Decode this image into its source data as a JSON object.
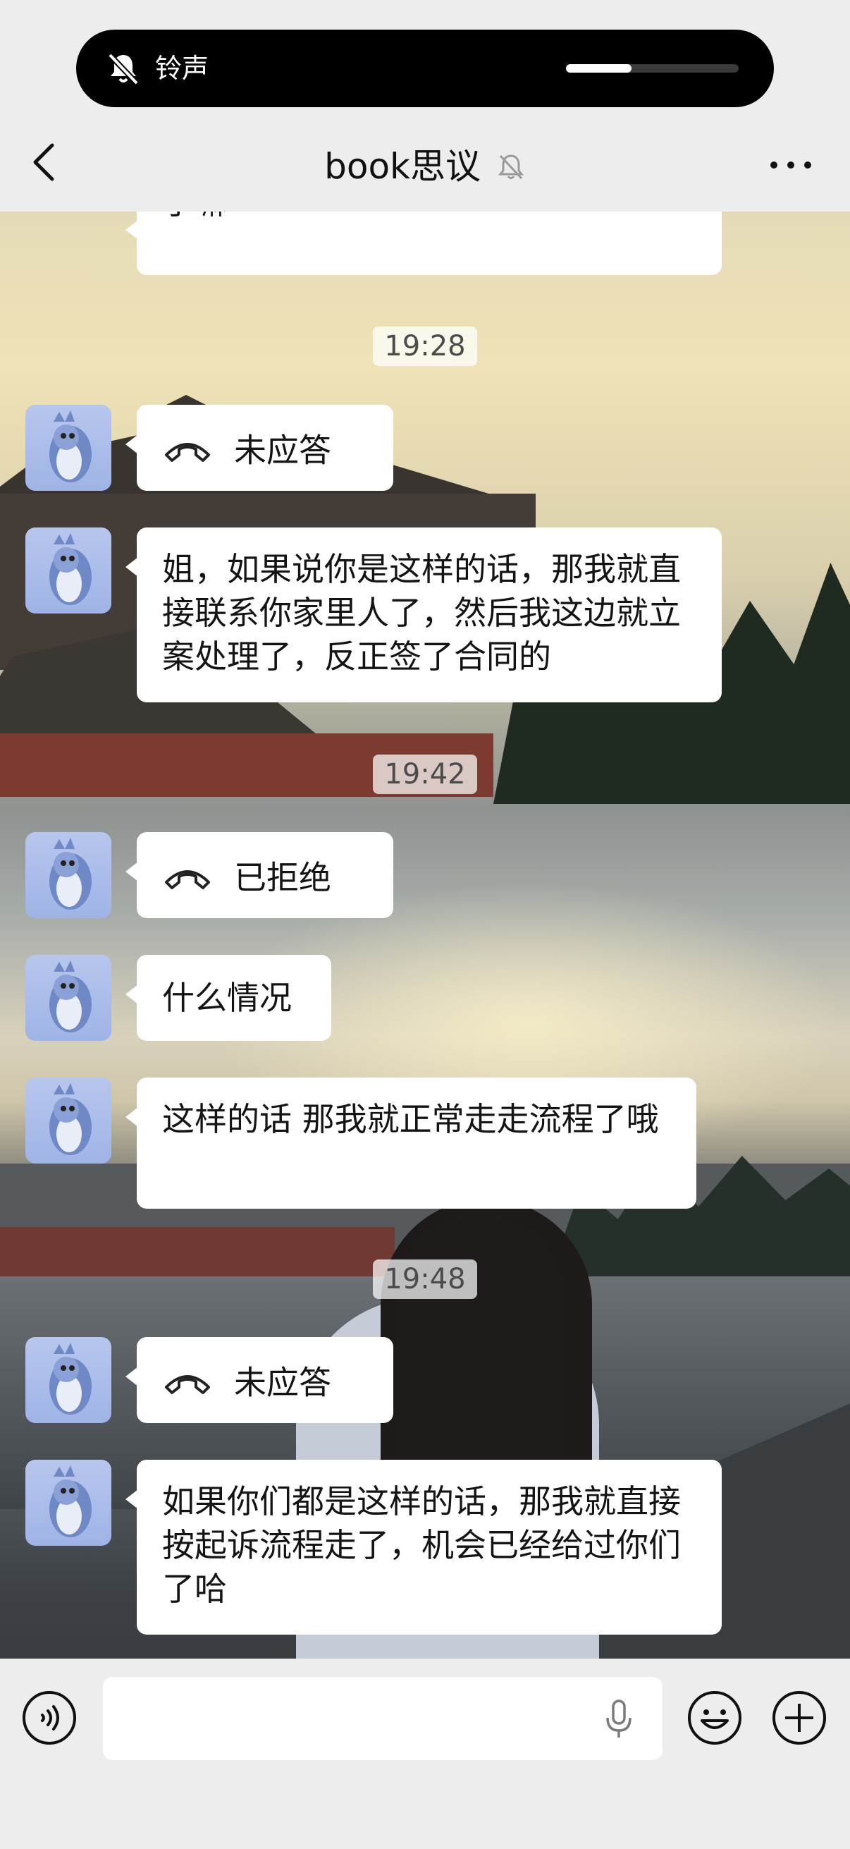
{
  "status_pill": {
    "label": "铃声",
    "volume_fraction": 0.38
  },
  "nav": {
    "title": "book思议"
  },
  "messages": [
    {
      "type": "text",
      "text": "了嘛"
    },
    {
      "type": "time",
      "text": "19:28"
    },
    {
      "type": "call",
      "text": "未应答"
    },
    {
      "type": "text",
      "text": " 姐，如果说你是这样的话，那我就直接联系你家里人了，然后我这边就立案处理了，反正签了合同的"
    },
    {
      "type": "time",
      "text": "19:42"
    },
    {
      "type": "call",
      "text": "已拒绝"
    },
    {
      "type": "text",
      "text": "什么情况"
    },
    {
      "type": "text",
      "text": "这样的话 那我就正常走走流程了哦"
    },
    {
      "type": "time",
      "text": "19:48"
    },
    {
      "type": "call",
      "text": "未应答"
    },
    {
      "type": "text",
      "text": "如果你们都是这样的话，那我就直接按起诉流程走了，机会已经给过你们了哈"
    }
  ],
  "input": {
    "value": ""
  },
  "icons": [
    "bell-slash-icon",
    "back-chevron-icon",
    "mute-bell-icon",
    "more-dots-icon",
    "phone-icon",
    "voice-icon",
    "mic-icon",
    "emoji-icon",
    "plus-icon"
  ],
  "colors": {
    "nav_bg": "#ededed",
    "bubble_bg": "#ffffff",
    "avatar_bg": "#b7c6ee",
    "pill_bg": "#000000"
  }
}
